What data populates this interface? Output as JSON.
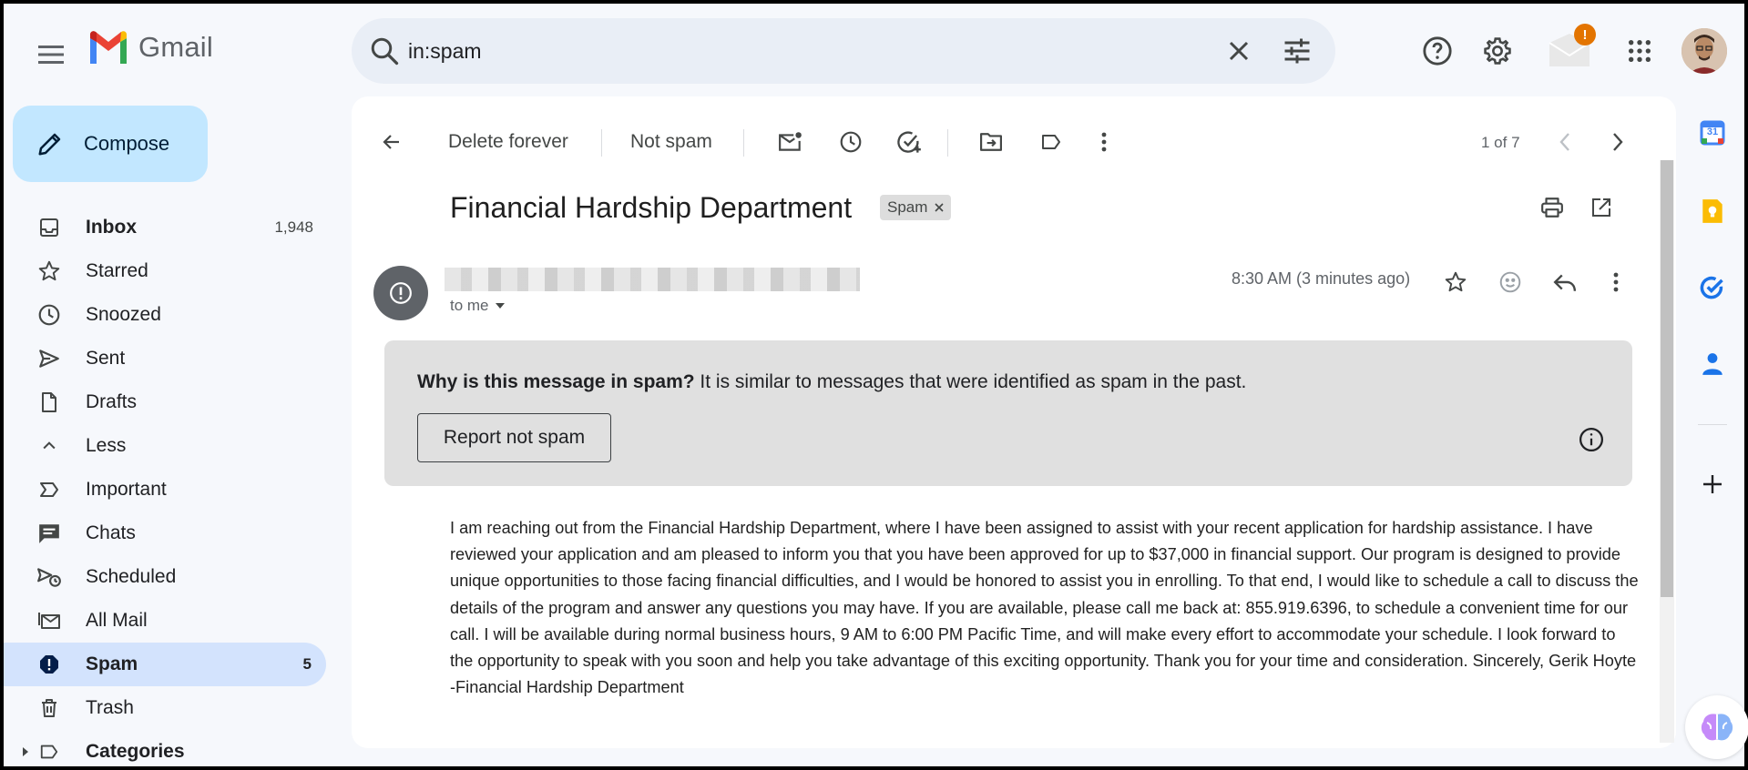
{
  "app": {
    "name": "Gmail"
  },
  "search": {
    "value": "in:spam"
  },
  "compose": {
    "label": "Compose"
  },
  "sidebar": {
    "items": [
      {
        "label": "Inbox",
        "count": "1,948"
      },
      {
        "label": "Starred",
        "count": ""
      },
      {
        "label": "Snoozed",
        "count": ""
      },
      {
        "label": "Sent",
        "count": ""
      },
      {
        "label": "Drafts",
        "count": ""
      },
      {
        "label": "Less",
        "count": ""
      },
      {
        "label": "Important",
        "count": ""
      },
      {
        "label": "Chats",
        "count": ""
      },
      {
        "label": "Scheduled",
        "count": ""
      },
      {
        "label": "All Mail",
        "count": ""
      },
      {
        "label": "Spam",
        "count": "5"
      },
      {
        "label": "Trash",
        "count": ""
      },
      {
        "label": "Categories",
        "count": ""
      }
    ]
  },
  "toolbar": {
    "delete_forever": "Delete forever",
    "not_spam": "Not spam",
    "pager": "1 of 7"
  },
  "message": {
    "subject": "Financial Hardship Department",
    "label_chip": "Spam",
    "to": "to me",
    "time": "8:30 AM (3 minutes ago)",
    "spam_notice_bold": "Why is this message in spam?",
    "spam_notice_text": " It is similar to messages that were identified as spam in the past.",
    "report_button": "Report not spam",
    "body": "I am reaching out from the Financial Hardship Department, where I have been assigned to assist with your recent application for hardship assistance. I have reviewed your application and am pleased to inform you that you have been approved for up to $37,000 in financial support. Our program is designed to provide unique opportunities to those facing financial difficulties, and I would be honored to assist you in enrolling. To that end, I would like to schedule a call to discuss the details of the program and answer any questions you may have. If you are available, please call me back at: 855.919.6396, to schedule a convenient time for our call. I will be available during normal business hours, 9 AM to 6:00 PM Pacific Time, and will make every effort to accommodate your schedule. I look forward to the opportunity to speak with you soon and help you take advantage of this exciting opportunity. Thank you for your time and consideration. Sincerely, Gerik Hoyte -Financial Hardship Department"
  },
  "header": {
    "notification_badge": "!"
  },
  "rail": {
    "calendar_day": "31"
  },
  "colors": {
    "background": "#f6f8fc",
    "compose_bg": "#c2e7ff",
    "active_nav": "#d3e3fd",
    "search_bg": "#e9eef6",
    "spam_notice_bg": "#e0e0e0",
    "badge": "#e37400"
  }
}
